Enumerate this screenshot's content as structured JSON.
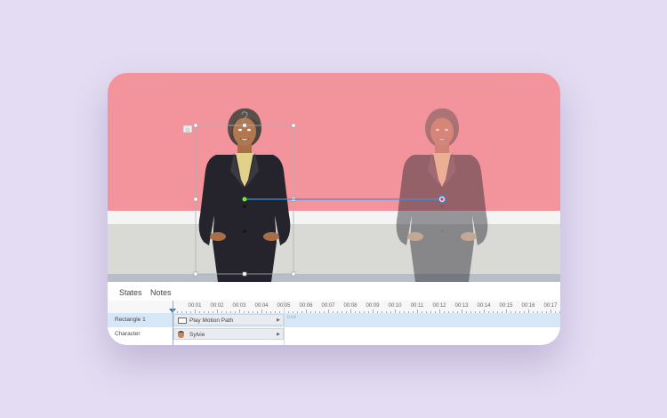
{
  "colors": {
    "background": "#e3dcf2",
    "wall": "#f3949d",
    "accent": "#1a7bd6",
    "selected_row": "#d6e7f7",
    "motion_end": "#e53946"
  },
  "panel": {
    "tabs": [
      {
        "label": "States"
      },
      {
        "label": "Notes"
      }
    ],
    "ruler": [
      "00:01",
      "00:02",
      "00:03",
      "00:04",
      "00:05",
      "00:06",
      "00:07",
      "00:08",
      "00:09",
      "00:10",
      "00:11",
      "00:12",
      "00:13",
      "00:14",
      "00:15",
      "00:16",
      "00:17"
    ],
    "end_label": "End",
    "rows": [
      {
        "label": "Rectangle 1",
        "bar": "Play Motion Path",
        "icon": "rectangle-icon",
        "selected": true
      },
      {
        "label": "Character",
        "bar": "Sylvie",
        "icon": "character-avatar-icon",
        "selected": false
      }
    ]
  }
}
